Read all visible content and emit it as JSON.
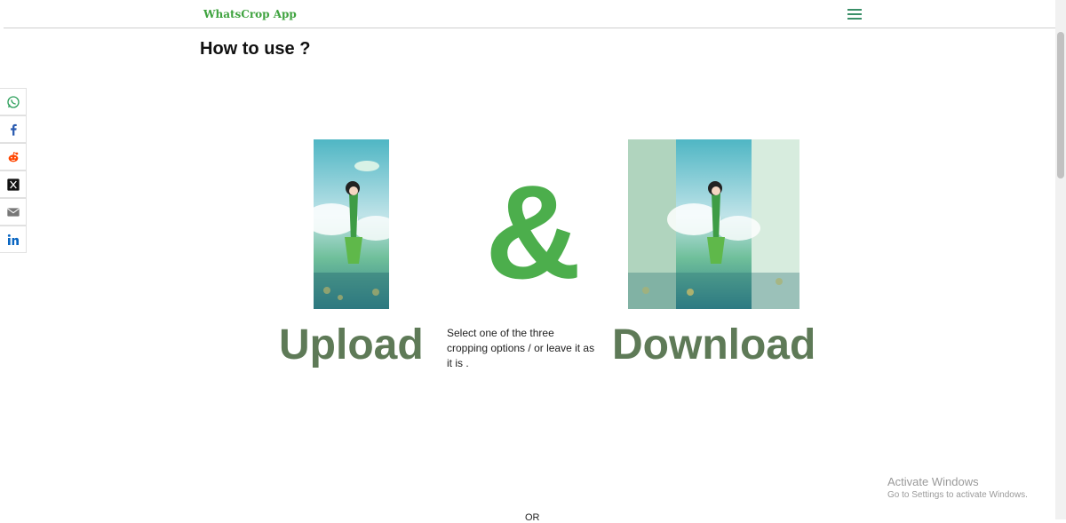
{
  "header": {
    "brand": "WhatsCrop App",
    "menu_icon": "hamburger-icon",
    "brand_color": "#3fa33f"
  },
  "main": {
    "title": "How to use ?",
    "ampersand": "&",
    "upload_label": "Upload",
    "download_label": "Download",
    "description": "Select one of the three cropping options / or leave it as it is .",
    "or_text": "OR",
    "accent_green": "#4cae4c",
    "label_color": "#5e7a57"
  },
  "share": {
    "items": [
      {
        "icon": "whatsapp-icon"
      },
      {
        "icon": "facebook-icon"
      },
      {
        "icon": "reddit-icon"
      },
      {
        "icon": "x-icon"
      },
      {
        "icon": "email-icon"
      },
      {
        "icon": "linkedin-icon"
      }
    ]
  },
  "watermark": {
    "title": "Activate Windows",
    "subtitle": "Go to Settings to activate Windows."
  }
}
